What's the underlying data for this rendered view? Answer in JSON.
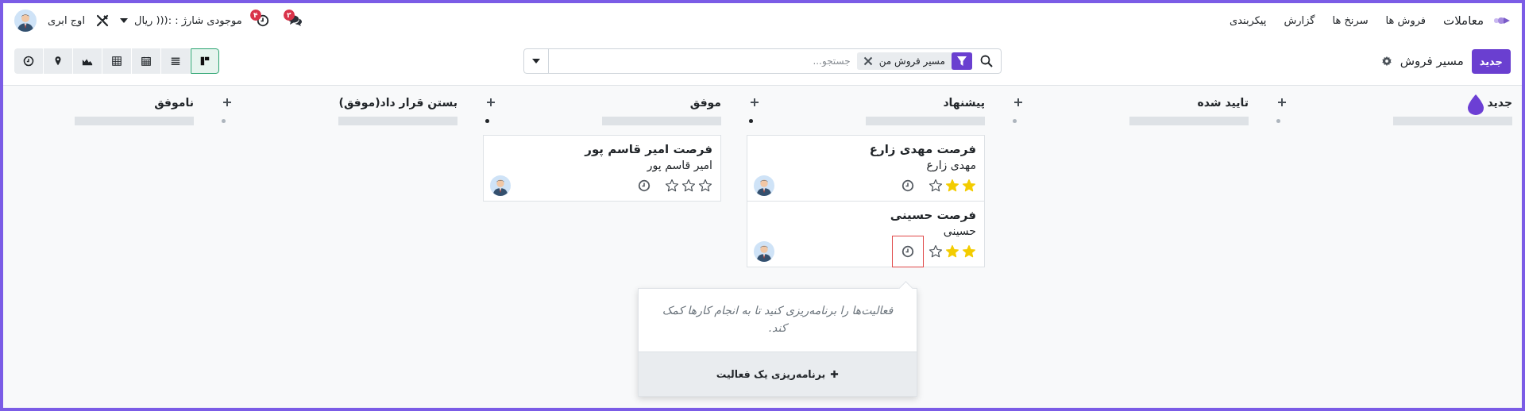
{
  "navbar": {
    "app_name": "معاملات",
    "menu": [
      "فروش ها",
      "سرنخ ها",
      "گزارش",
      "پیکربندی"
    ],
    "messages_badge": "۲",
    "activities_badge": "۴",
    "balance": "موجودی شارژ : :((( ریال",
    "company": "اوج ابری"
  },
  "control_panel": {
    "new_button": "جدید",
    "breadcrumb": "مسیر فروش",
    "search": {
      "facet": "مسیر فروش من",
      "placeholder": "جستجو..."
    },
    "views": [
      {
        "kind": "kanban",
        "selected": true
      },
      {
        "kind": "list",
        "selected": false
      },
      {
        "kind": "calendar",
        "selected": false
      },
      {
        "kind": "pivot",
        "selected": false
      },
      {
        "kind": "graph",
        "selected": false
      },
      {
        "kind": "map",
        "selected": false
      },
      {
        "kind": "activity",
        "selected": false
      }
    ]
  },
  "columns": [
    {
      "title": "جدید",
      "active": false
    },
    {
      "title": "تایید شده",
      "active": false
    },
    {
      "title": "پیشنهاد",
      "active": true,
      "cards": [
        {
          "title": "فرصت مهدی زارع",
          "contact": "مهدی زارع",
          "stars": 2,
          "activity_focused": false
        },
        {
          "title": "فرصت حسینی",
          "contact": "حسینی",
          "stars": 2,
          "activity_focused": true
        }
      ]
    },
    {
      "title": "موفق",
      "active": true,
      "cards": [
        {
          "title": "فرصت امیر قاسم پور",
          "contact": "امیر قاسم پور",
          "stars": 0,
          "activity_focused": false
        }
      ]
    },
    {
      "title": "بستن قرار داد(موفق)",
      "active": false
    },
    {
      "title": "ناموفق"
    }
  ],
  "popover": {
    "message": "فعالیت‌ها را برنامه‌ریزی کنید تا به انجام کارها کمک کند.",
    "button": "برنامه‌ریزی یک فعالیت"
  }
}
